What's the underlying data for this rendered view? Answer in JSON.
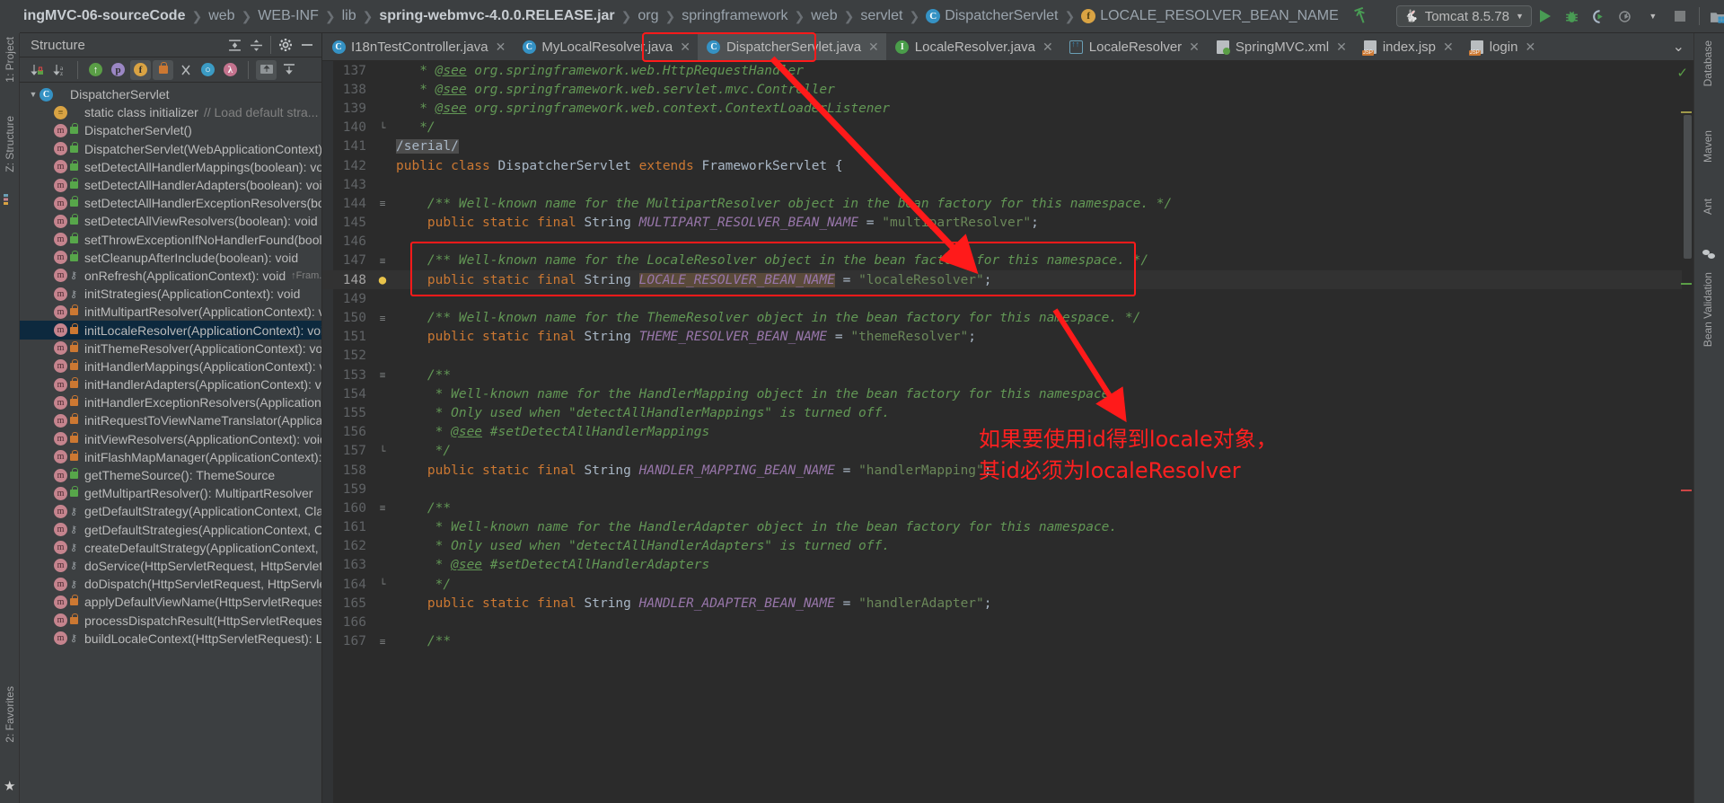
{
  "breadcrumbs": [
    {
      "label": "ingMVC-06-sourceCode",
      "style": "bold"
    },
    {
      "label": "web",
      "style": "normal"
    },
    {
      "label": "WEB-INF",
      "style": "normal"
    },
    {
      "label": "lib",
      "style": "normal"
    },
    {
      "label": "spring-webmvc-4.0.0.RELEASE.jar",
      "style": "bold"
    },
    {
      "label": "org",
      "style": "normal"
    },
    {
      "label": "springframework",
      "style": "normal"
    },
    {
      "label": "web",
      "style": "normal"
    },
    {
      "label": "servlet",
      "style": "normal"
    },
    {
      "label": "DispatcherServlet",
      "style": "icon-class"
    },
    {
      "label": "LOCALE_RESOLVER_BEAN_NAME",
      "style": "icon-field"
    }
  ],
  "toolbar": {
    "run_config": "Tomcat 8.5.78",
    "icons": [
      "run-icon",
      "debug-icon",
      "run-with-coverage-icon",
      "profiler-icon",
      "stop-icon",
      "project-structure-icon",
      "terminal-icon",
      "search-everywhere-icon"
    ]
  },
  "structure": {
    "title": "Structure",
    "header_icons": [
      "expand-all-icon",
      "collapse-all-icon",
      "settings-gear-icon",
      "hide-icon"
    ],
    "toolbar_icons": [
      "sort-by-visibility-icon",
      "sort-alphabetically-icon",
      "show-inherited-icon",
      "show-properties-icon",
      "show-fields-icon",
      "show-non-public-icon",
      "show-anonymous-icon",
      "show-constructors-icon",
      "show-lambdas-icon",
      "autoscroll-to-source-icon",
      "autoscroll-from-source-icon"
    ],
    "items": [
      {
        "label": "DispatcherServlet",
        "icon": "class-icon",
        "vis": "none",
        "indent": 0,
        "twisty": "▼",
        "selected": false,
        "comment": ""
      },
      {
        "label": "static class initializer",
        "icon": "initializer-icon",
        "vis": "none",
        "indent": 1,
        "twisty": "",
        "selected": false,
        "comment": "// Load default stra..."
      },
      {
        "label": "DispatcherServlet()",
        "icon": "method-icon",
        "vis": "public",
        "indent": 1,
        "twisty": "",
        "selected": false,
        "comment": ""
      },
      {
        "label": "DispatcherServlet(WebApplicationContext)",
        "icon": "method-icon",
        "vis": "public",
        "indent": 1,
        "twisty": "",
        "selected": false,
        "comment": ""
      },
      {
        "label": "setDetectAllHandlerMappings(boolean): void",
        "icon": "method-icon",
        "vis": "public",
        "indent": 1,
        "twisty": "",
        "selected": false,
        "comment": ""
      },
      {
        "label": "setDetectAllHandlerAdapters(boolean): void",
        "icon": "method-icon",
        "vis": "public",
        "indent": 1,
        "twisty": "",
        "selected": false,
        "comment": ""
      },
      {
        "label": "setDetectAllHandlerExceptionResolvers(boolean): void",
        "icon": "method-icon",
        "vis": "public",
        "indent": 1,
        "twisty": "",
        "selected": false,
        "comment": ""
      },
      {
        "label": "setDetectAllViewResolvers(boolean): void",
        "icon": "method-icon",
        "vis": "public",
        "indent": 1,
        "twisty": "",
        "selected": false,
        "comment": ""
      },
      {
        "label": "setThrowExceptionIfNoHandlerFound(boolean): void",
        "icon": "method-icon",
        "vis": "public",
        "indent": 1,
        "twisty": "",
        "selected": false,
        "comment": ""
      },
      {
        "label": "setCleanupAfterInclude(boolean): void",
        "icon": "method-icon",
        "vis": "public",
        "indent": 1,
        "twisty": "",
        "selected": false,
        "comment": ""
      },
      {
        "label": "onRefresh(ApplicationContext): void",
        "icon": "method-icon",
        "vis": "protected",
        "indent": 1,
        "twisty": "",
        "selected": false,
        "comment": "↑Fram..."
      },
      {
        "label": "initStrategies(ApplicationContext): void",
        "icon": "method-icon",
        "vis": "protected",
        "indent": 1,
        "twisty": "",
        "selected": false,
        "comment": ""
      },
      {
        "label": "initMultipartResolver(ApplicationContext): void",
        "icon": "method-icon",
        "vis": "private",
        "indent": 1,
        "twisty": "",
        "selected": false,
        "comment": ""
      },
      {
        "label": "initLocaleResolver(ApplicationContext): void",
        "icon": "method-icon",
        "vis": "private",
        "indent": 1,
        "twisty": "",
        "selected": true,
        "comment": ""
      },
      {
        "label": "initThemeResolver(ApplicationContext): void",
        "icon": "method-icon",
        "vis": "private",
        "indent": 1,
        "twisty": "",
        "selected": false,
        "comment": ""
      },
      {
        "label": "initHandlerMappings(ApplicationContext): void",
        "icon": "method-icon",
        "vis": "private",
        "indent": 1,
        "twisty": "",
        "selected": false,
        "comment": ""
      },
      {
        "label": "initHandlerAdapters(ApplicationContext): void",
        "icon": "method-icon",
        "vis": "private",
        "indent": 1,
        "twisty": "",
        "selected": false,
        "comment": ""
      },
      {
        "label": "initHandlerExceptionResolvers(ApplicationContext): void",
        "icon": "method-icon",
        "vis": "private",
        "indent": 1,
        "twisty": "",
        "selected": false,
        "comment": ""
      },
      {
        "label": "initRequestToViewNameTranslator(ApplicationContext): void",
        "icon": "method-icon",
        "vis": "private",
        "indent": 1,
        "twisty": "",
        "selected": false,
        "comment": ""
      },
      {
        "label": "initViewResolvers(ApplicationContext): void",
        "icon": "method-icon",
        "vis": "private",
        "indent": 1,
        "twisty": "",
        "selected": false,
        "comment": ""
      },
      {
        "label": "initFlashMapManager(ApplicationContext): void",
        "icon": "method-icon",
        "vis": "private",
        "indent": 1,
        "twisty": "",
        "selected": false,
        "comment": ""
      },
      {
        "label": "getThemeSource(): ThemeSource",
        "icon": "method-override-icon",
        "vis": "public",
        "indent": 1,
        "twisty": "",
        "selected": false,
        "comment": ""
      },
      {
        "label": "getMultipartResolver(): MultipartResolver",
        "icon": "method-override-icon",
        "vis": "public",
        "indent": 1,
        "twisty": "",
        "selected": false,
        "comment": ""
      },
      {
        "label": "getDefaultStrategy(ApplicationContext, Class): Object",
        "icon": "method-icon",
        "vis": "protected",
        "indent": 1,
        "twisty": "",
        "selected": false,
        "comment": ""
      },
      {
        "label": "getDefaultStrategies(ApplicationContext, Class): List",
        "icon": "method-icon",
        "vis": "protected",
        "indent": 1,
        "twisty": "",
        "selected": false,
        "comment": ""
      },
      {
        "label": "createDefaultStrategy(ApplicationContext, Class): Object",
        "icon": "method-icon",
        "vis": "protected",
        "indent": 1,
        "twisty": "",
        "selected": false,
        "comment": ""
      },
      {
        "label": "doService(HttpServletRequest, HttpServletResponse): void",
        "icon": "method-icon",
        "vis": "protected",
        "indent": 1,
        "twisty": "",
        "selected": false,
        "comment": ""
      },
      {
        "label": "doDispatch(HttpServletRequest, HttpServletResponse): void",
        "icon": "method-icon",
        "vis": "protected",
        "indent": 1,
        "twisty": "",
        "selected": false,
        "comment": ""
      },
      {
        "label": "applyDefaultViewName(HttpServletRequest, ModelAndView): void",
        "icon": "method-icon",
        "vis": "private",
        "indent": 1,
        "twisty": "",
        "selected": false,
        "comment": ""
      },
      {
        "label": "processDispatchResult(HttpServletRequest, ...): void",
        "icon": "method-icon",
        "vis": "private",
        "indent": 1,
        "twisty": "",
        "selected": false,
        "comment": ""
      },
      {
        "label": "buildLocaleContext(HttpServletRequest): LocaleContext",
        "icon": "method-icon",
        "vis": "protected",
        "indent": 1,
        "twisty": "",
        "selected": false,
        "comment": ""
      }
    ]
  },
  "sidebar_left": {
    "top_label": "1: Project",
    "mid_label": "Z: Structure",
    "bottom_label": "2: Favorites"
  },
  "sidebar_right": {
    "labels": [
      "Database",
      "Maven",
      "Ant",
      "Bean Validation"
    ]
  },
  "tabs": [
    {
      "label": "I18nTestController.java",
      "icon": "java-class-icon",
      "active": false
    },
    {
      "label": "MyLocalResolver.java",
      "icon": "java-class-icon",
      "active": false
    },
    {
      "label": "DispatcherServlet.java",
      "icon": "java-class-readonly-icon",
      "active": true
    },
    {
      "label": "LocaleResolver.java",
      "icon": "java-interface-icon",
      "active": false
    },
    {
      "label": "LocaleResolver",
      "icon": "uml-diagram-icon",
      "active": false
    },
    {
      "label": "SpringMVC.xml",
      "icon": "xml-file-icon",
      "active": false
    },
    {
      "label": "index.jsp",
      "icon": "jsp-file-icon",
      "active": false
    },
    {
      "label": "login",
      "icon": "jsp-file-icon",
      "active": false
    }
  ],
  "editor": {
    "lines": [
      {
        "no": "137",
        "gutter": "",
        "current": false,
        "tokens": [
          {
            "t": "   * ",
            "c": "cmt"
          },
          {
            "t": "@see",
            "c": "cmtd"
          },
          {
            "t": " org.springframework.web.HttpRequestHandler",
            "c": "cmt"
          }
        ]
      },
      {
        "no": "138",
        "gutter": "",
        "current": false,
        "tokens": [
          {
            "t": "   * ",
            "c": "cmt"
          },
          {
            "t": "@see",
            "c": "cmtd"
          },
          {
            "t": " org.springframework.web.servlet.mvc.Controller",
            "c": "cmt"
          }
        ]
      },
      {
        "no": "139",
        "gutter": "",
        "current": false,
        "tokens": [
          {
            "t": "   * ",
            "c": "cmt"
          },
          {
            "t": "@see",
            "c": "cmtd"
          },
          {
            "t": " org.springframework.web.context.ContextLoaderListener",
            "c": "cmt"
          }
        ]
      },
      {
        "no": "140",
        "gutter": "fold-end",
        "current": false,
        "tokens": [
          {
            "t": "   */",
            "c": "cmt"
          }
        ]
      },
      {
        "no": "141",
        "gutter": "",
        "current": false,
        "tokens": [
          {
            "t": "/serial/",
            "c": "serial"
          }
        ]
      },
      {
        "no": "142",
        "gutter": "",
        "current": false,
        "tokens": [
          {
            "t": "public class ",
            "c": "kw"
          },
          {
            "t": "DispatcherServlet ",
            "c": "typ"
          },
          {
            "t": "extends ",
            "c": "kw"
          },
          {
            "t": "FrameworkServlet {",
            "c": "typ"
          }
        ]
      },
      {
        "no": "143",
        "gutter": "",
        "current": false,
        "tokens": []
      },
      {
        "no": "144",
        "gutter": "doc",
        "current": false,
        "tokens": [
          {
            "t": "    /** Well-known name for the MultipartResolver object in the bean factory for this namespace. */",
            "c": "cmt"
          }
        ]
      },
      {
        "no": "145",
        "gutter": "",
        "current": false,
        "tokens": [
          {
            "t": "    public static final ",
            "c": "kw"
          },
          {
            "t": "String ",
            "c": "typ"
          },
          {
            "t": "MULTIPART_RESOLVER_BEAN_NAME",
            "c": "fld"
          },
          {
            "t": " = ",
            "c": "pun"
          },
          {
            "t": "\"multipartResolver\"",
            "c": "str"
          },
          {
            "t": ";",
            "c": "pun"
          }
        ]
      },
      {
        "no": "146",
        "gutter": "",
        "current": false,
        "tokens": []
      },
      {
        "no": "147",
        "gutter": "doc",
        "current": false,
        "tokens": [
          {
            "t": "    /** Well-known name for the LocaleResolver object in the bean factory for this namespace. */",
            "c": "cmt"
          }
        ]
      },
      {
        "no": "148",
        "gutter": "bulb",
        "current": true,
        "tokens": [
          {
            "t": "    public static final ",
            "c": "kw"
          },
          {
            "t": "String ",
            "c": "typ"
          },
          {
            "t": "LOCALE_RESOLVER_BEAN_NAME",
            "c": "fldhl"
          },
          {
            "t": " = ",
            "c": "pun"
          },
          {
            "t": "\"localeResolver\"",
            "c": "str"
          },
          {
            "t": ";",
            "c": "pun"
          }
        ]
      },
      {
        "no": "149",
        "gutter": "",
        "current": false,
        "tokens": []
      },
      {
        "no": "150",
        "gutter": "doc",
        "current": false,
        "tokens": [
          {
            "t": "    /** Well-known name for the ThemeResolver object in the bean factory for this namespace. */",
            "c": "cmt"
          }
        ]
      },
      {
        "no": "151",
        "gutter": "",
        "current": false,
        "tokens": [
          {
            "t": "    public static final ",
            "c": "kw"
          },
          {
            "t": "String ",
            "c": "typ"
          },
          {
            "t": "THEME_RESOLVER_BEAN_NAME",
            "c": "fld"
          },
          {
            "t": " = ",
            "c": "pun"
          },
          {
            "t": "\"themeResolver\"",
            "c": "str"
          },
          {
            "t": ";",
            "c": "pun"
          }
        ]
      },
      {
        "no": "152",
        "gutter": "",
        "current": false,
        "tokens": []
      },
      {
        "no": "153",
        "gutter": "doc-fold",
        "current": false,
        "tokens": [
          {
            "t": "    /**",
            "c": "cmt"
          }
        ]
      },
      {
        "no": "154",
        "gutter": "",
        "current": false,
        "tokens": [
          {
            "t": "     * Well-known name for the HandlerMapping object in the bean factory for this namespace.",
            "c": "cmt"
          }
        ]
      },
      {
        "no": "155",
        "gutter": "",
        "current": false,
        "tokens": [
          {
            "t": "     * Only used when \"detectAllHandlerMappings\" is turned off.",
            "c": "cmt"
          }
        ]
      },
      {
        "no": "156",
        "gutter": "",
        "current": false,
        "tokens": [
          {
            "t": "     * ",
            "c": "cmt"
          },
          {
            "t": "@see",
            "c": "cmtd"
          },
          {
            "t": " #setDetectAllHandlerMappings",
            "c": "cmt"
          }
        ]
      },
      {
        "no": "157",
        "gutter": "fold-end",
        "current": false,
        "tokens": [
          {
            "t": "     */",
            "c": "cmt"
          }
        ]
      },
      {
        "no": "158",
        "gutter": "",
        "current": false,
        "tokens": [
          {
            "t": "    public static final ",
            "c": "kw"
          },
          {
            "t": "String ",
            "c": "typ"
          },
          {
            "t": "HANDLER_MAPPING_BEAN_NAME",
            "c": "fld"
          },
          {
            "t": " = ",
            "c": "pun"
          },
          {
            "t": "\"handlerMapping\"",
            "c": "str"
          },
          {
            "t": ";",
            "c": "pun"
          }
        ]
      },
      {
        "no": "159",
        "gutter": "",
        "current": false,
        "tokens": []
      },
      {
        "no": "160",
        "gutter": "doc-fold",
        "current": false,
        "tokens": [
          {
            "t": "    /**",
            "c": "cmt"
          }
        ]
      },
      {
        "no": "161",
        "gutter": "",
        "current": false,
        "tokens": [
          {
            "t": "     * Well-known name for the HandlerAdapter object in the bean factory for this namespace.",
            "c": "cmt"
          }
        ]
      },
      {
        "no": "162",
        "gutter": "",
        "current": false,
        "tokens": [
          {
            "t": "     * Only used when \"detectAllHandlerAdapters\" is turned off.",
            "c": "cmt"
          }
        ]
      },
      {
        "no": "163",
        "gutter": "",
        "current": false,
        "tokens": [
          {
            "t": "     * ",
            "c": "cmt"
          },
          {
            "t": "@see",
            "c": "cmtd"
          },
          {
            "t": " #setDetectAllHandlerAdapters",
            "c": "cmt"
          }
        ]
      },
      {
        "no": "164",
        "gutter": "fold-end",
        "current": false,
        "tokens": [
          {
            "t": "     */",
            "c": "cmt"
          }
        ]
      },
      {
        "no": "165",
        "gutter": "",
        "current": false,
        "tokens": [
          {
            "t": "    public static final ",
            "c": "kw"
          },
          {
            "t": "String ",
            "c": "typ"
          },
          {
            "t": "HANDLER_ADAPTER_BEAN_NAME",
            "c": "fld"
          },
          {
            "t": " = ",
            "c": "pun"
          },
          {
            "t": "\"handlerAdapter\"",
            "c": "str"
          },
          {
            "t": ";",
            "c": "pun"
          }
        ]
      },
      {
        "no": "166",
        "gutter": "",
        "current": false,
        "tokens": []
      },
      {
        "no": "167",
        "gutter": "doc-fold",
        "current": false,
        "tokens": [
          {
            "t": "    /**",
            "c": "cmt"
          }
        ]
      }
    ]
  },
  "annotation": {
    "chinese_note": "如果要使用id得到locale对象，\n其id必须为localeResolver",
    "color": "#ff2020"
  }
}
